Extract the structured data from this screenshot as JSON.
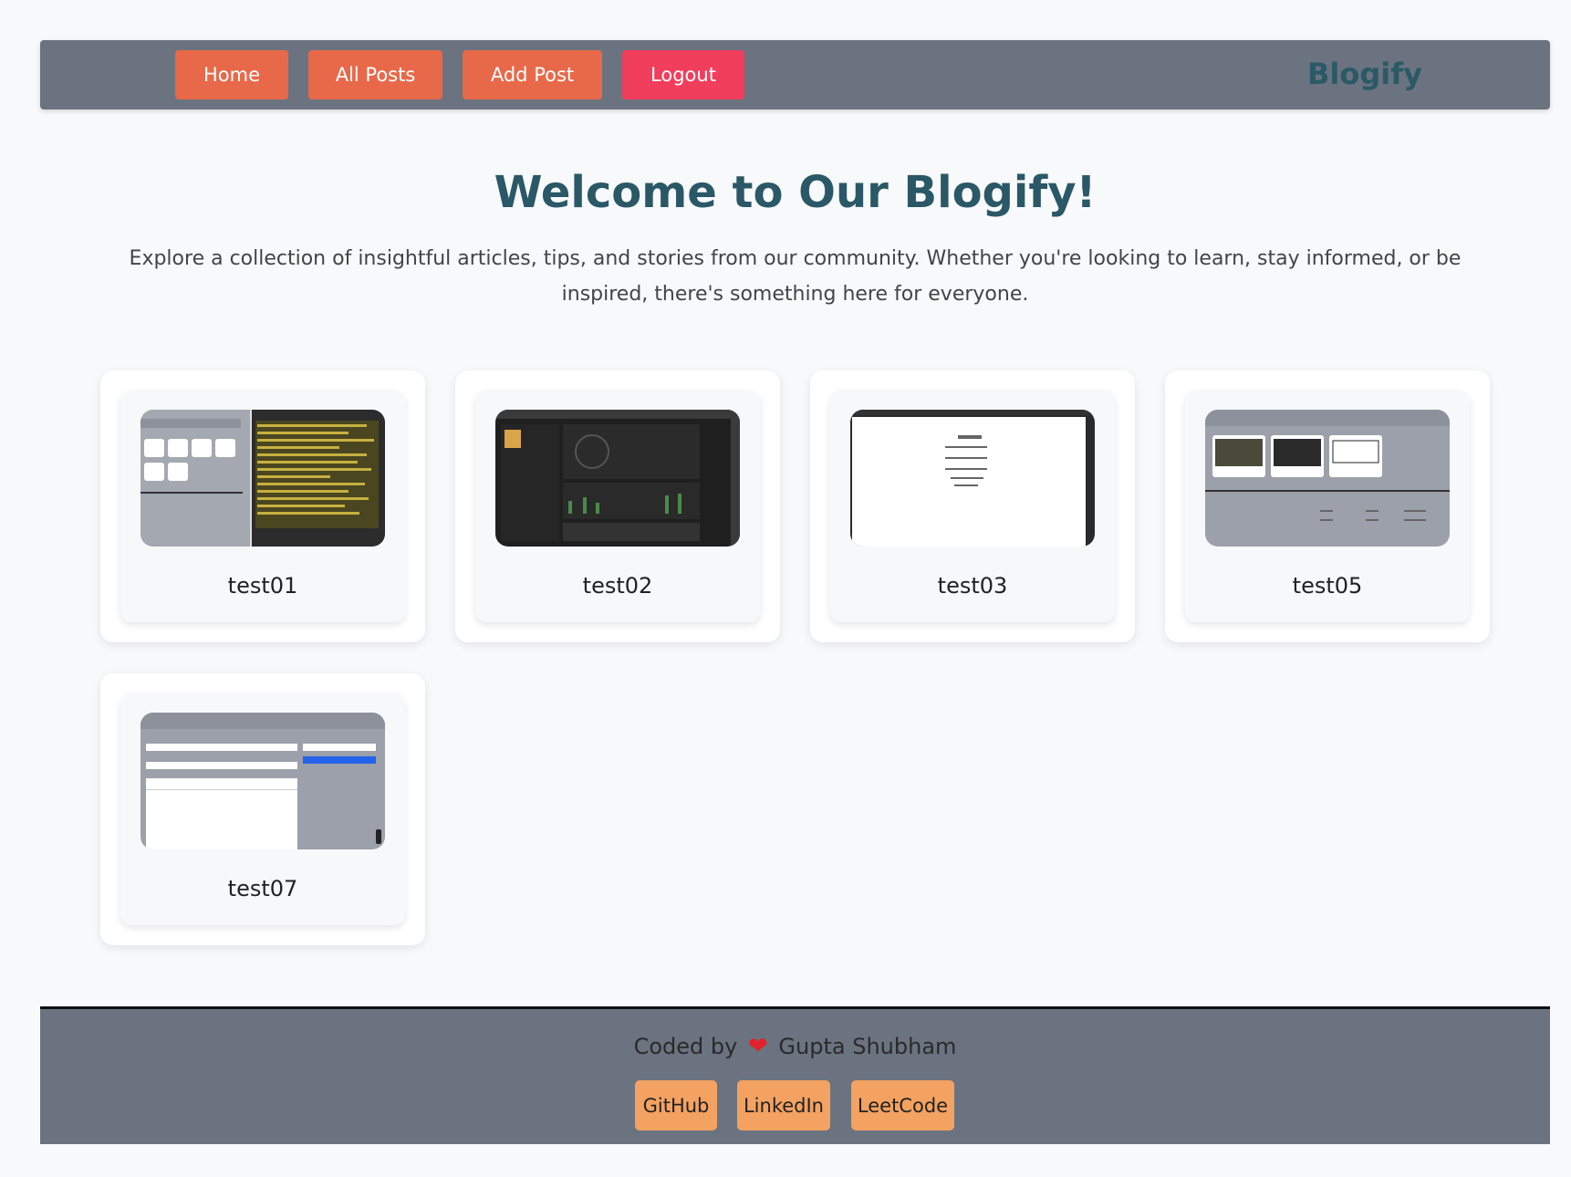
{
  "nav": {
    "home": "Home",
    "all_posts": "All Posts",
    "add_post": "Add Post",
    "logout": "Logout",
    "brand": "Blogify"
  },
  "hero": {
    "title": "Welcome to Our Blogify!",
    "subtitle": "Explore a collection of insightful articles, tips, and stories from our community. Whether you're looking to learn, stay informed, or be inspired, there's something here for everyone."
  },
  "posts": [
    {
      "title": "test01"
    },
    {
      "title": "test02"
    },
    {
      "title": "test03"
    },
    {
      "title": "test05"
    },
    {
      "title": "test07"
    }
  ],
  "footer": {
    "coded_by": "Coded by",
    "author": "Gupta Shubham",
    "links": [
      "GitHub",
      "LinkedIn",
      "LeetCode"
    ]
  },
  "colors": {
    "nav_bg": "#6b7280",
    "nav_button": "#e8694a",
    "logout_button": "#f03e5c",
    "brand": "#2a5a66",
    "footer_button": "#f4a261"
  }
}
